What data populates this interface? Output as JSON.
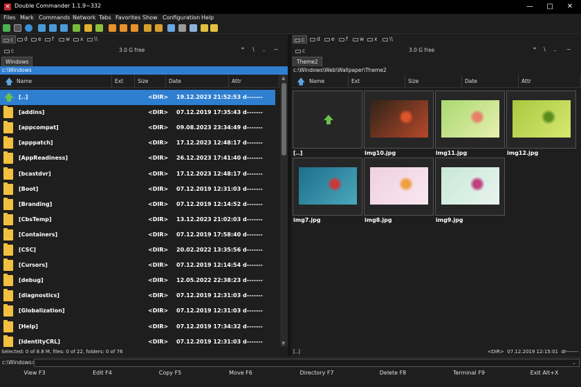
{
  "titlebar": {
    "title": "Double Commander 1.1.9~332",
    "minimize": "—",
    "maximize": "□",
    "close": "✕"
  },
  "menu": [
    "Files",
    "Mark",
    "Commands",
    "Network",
    "Tabs",
    "Favorites",
    "Show",
    "Configuration",
    "Help"
  ],
  "toolbar_icons": [
    "refresh-icon",
    "terminal-icon",
    "search-files-icon",
    "view-brief-icon",
    "view-columns-icon",
    "view-thumbnails-icon",
    "view-full-icon",
    "copy-icon",
    "move-icon",
    "select-icon",
    "delete-icon",
    "edit-icon",
    "pack-icon",
    "unpack-icon",
    "compare-icon",
    "sync-icon",
    "split-icon",
    "properties-icon",
    "folder-icon",
    "multi-rename-icon"
  ],
  "left": {
    "drives": [
      "c",
      "d",
      "e",
      "f",
      "w",
      "x",
      "\\\\"
    ],
    "active_drive": "c",
    "drive_label": "c",
    "free": "3.0 G free",
    "nav_buttons": [
      "*",
      "\\",
      "..",
      "~"
    ],
    "tab": "Windows",
    "path": "c:\\Windows",
    "columns": [
      "Name",
      "Ext",
      "Size",
      "Date",
      "Attr"
    ],
    "rows": [
      {
        "name": "[..]",
        "size": "<DIR>",
        "date": "19.12.2023 21:52:53 d-------",
        "up": true
      },
      {
        "name": "[addins]",
        "size": "<DIR>",
        "date": "07.12.2019 17:35:43 d-------"
      },
      {
        "name": "[appcompat]",
        "size": "<DIR>",
        "date": "09.08.2023 23:34:49 d-------"
      },
      {
        "name": "[apppatch]",
        "size": "<DIR>",
        "date": "17.12.2023 12:48:17 d-------"
      },
      {
        "name": "[AppReadiness]",
        "size": "<DIR>",
        "date": "26.12.2023 17:41:40 d-------"
      },
      {
        "name": "[bcastdvr]",
        "size": "<DIR>",
        "date": "17.12.2023 12:48:17 d-------"
      },
      {
        "name": "[Boot]",
        "size": "<DIR>",
        "date": "07.12.2019 12:31:03 d-------"
      },
      {
        "name": "[Branding]",
        "size": "<DIR>",
        "date": "07.12.2019 12:14:52 d-------"
      },
      {
        "name": "[CbsTemp]",
        "size": "<DIR>",
        "date": "13.12.2023 21:02:03 d-------"
      },
      {
        "name": "[Containers]",
        "size": "<DIR>",
        "date": "07.12.2019 17:58:40 d-------"
      },
      {
        "name": "[CSC]",
        "size": "<DIR>",
        "date": "20.02.2022 13:35:56 d-------"
      },
      {
        "name": "[Cursors]",
        "size": "<DIR>",
        "date": "07.12.2019 12:14:54 d-------"
      },
      {
        "name": "[debug]",
        "size": "<DIR>",
        "date": "12.05.2022 22:38:23 d-------"
      },
      {
        "name": "[diagnostics]",
        "size": "<DIR>",
        "date": "07.12.2019 12:31:03 d-------"
      },
      {
        "name": "[Globalization]",
        "size": "<DIR>",
        "date": "07.12.2019 12:31:03 d-------"
      },
      {
        "name": "[Help]",
        "size": "<DIR>",
        "date": "07.12.2019 17:34:32 d-------"
      },
      {
        "name": "[IdentityCRL]",
        "size": "<DIR>",
        "date": "07.12.2019 12:31:03 d-------"
      }
    ],
    "status": "Selected: 0 of 8.8 M, files: 0 of 22, folders: 0 of 76"
  },
  "right": {
    "drives": [
      "c",
      "d",
      "e",
      "f",
      "w",
      "x",
      "\\\\"
    ],
    "active_drive": "c",
    "drive_label": "c",
    "free": "3.0 G free",
    "nav_buttons": [
      "*",
      "\\",
      "..",
      "~"
    ],
    "tab": "Theme2",
    "path": "c:\\Windows\\Web\\Wallpaper\\Theme2",
    "columns": [
      "Name",
      "Ext",
      "Size",
      "Date",
      "Attr"
    ],
    "thumbs": [
      {
        "name": "[..]",
        "up": true
      },
      {
        "name": "img10.jpg",
        "colors": [
          "#2e2418",
          "#b8482a",
          "#e0542c"
        ]
      },
      {
        "name": "img11.jpg",
        "colors": [
          "#a8d870",
          "#e8f0b0",
          "#e8806a"
        ]
      },
      {
        "name": "img12.jpg",
        "colors": [
          "#a8c840",
          "#d8e870",
          "#5a8c1c"
        ]
      },
      {
        "name": "img7.jpg",
        "colors": [
          "#1e6e8a",
          "#4aa8bc",
          "#c83a3a"
        ]
      },
      {
        "name": "img8.jpg",
        "colors": [
          "#f0d0e0",
          "#f8e8f0",
          "#f0a040"
        ]
      },
      {
        "name": "img9.jpg",
        "colors": [
          "#c8e8d8",
          "#e8f4ee",
          "#c04080"
        ]
      }
    ],
    "status_name": "[..]",
    "status_info": "<DIR>  07.12.2019 12:15:01  dr-------"
  },
  "commandline": {
    "label": "c:\\Windows>",
    "value": ""
  },
  "fkeys": [
    "View F3",
    "Edit F4",
    "Copy F5",
    "Move F6",
    "Directory F7",
    "Delete F8",
    "Terminal F9",
    "Exit Alt+X"
  ]
}
